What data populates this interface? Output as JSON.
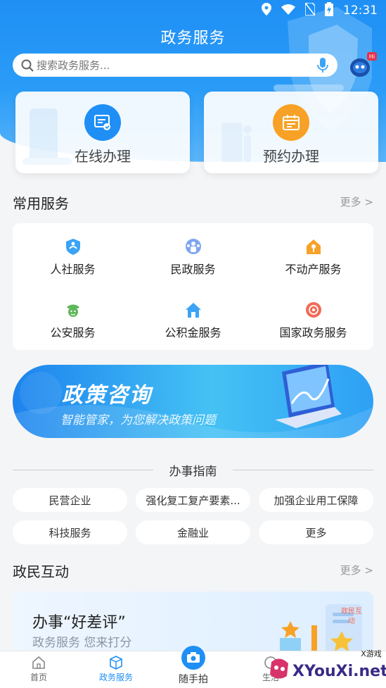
{
  "status_bar": {
    "time": "12:31"
  },
  "header": {
    "title": "政务服务",
    "search_placeholder": "搜索政务服务...",
    "robot_badge": "Hi"
  },
  "top_cards": [
    {
      "label": "在线办理",
      "color": "#1f8ff5"
    },
    {
      "label": "预约办理",
      "color": "#f7a227"
    }
  ],
  "common_services": {
    "title": "常用服务",
    "more": "更多 >",
    "items": [
      {
        "label": "人社服务",
        "icon": "people-badge-icon"
      },
      {
        "label": "民政服务",
        "icon": "civil-affairs-icon"
      },
      {
        "label": "不动产服务",
        "icon": "house-key-icon"
      },
      {
        "label": "公安服务",
        "icon": "police-icon"
      },
      {
        "label": "公积金服务",
        "icon": "home-fund-icon"
      },
      {
        "label": "国家政务服务",
        "icon": "national-emblem-icon"
      }
    ]
  },
  "banner": {
    "title": "政策咨询",
    "subtitle": "智能管家，为您解决政策问题"
  },
  "guide": {
    "title": "办事指南",
    "tags": [
      "民营企业",
      "强化复工复产要素...",
      "加强企业用工保障",
      "科技服务",
      "金融业",
      "更多"
    ]
  },
  "interaction": {
    "title": "政民互动",
    "more": "更多 >",
    "card_title": "办事“好差评”",
    "card_subtitle": "政务服务 您来打分",
    "card_badge": "政民互动"
  },
  "bottom_nav": {
    "items": [
      {
        "label": "首页",
        "active": false
      },
      {
        "label": "政务服务",
        "active": true
      },
      {
        "label": "随手拍",
        "active": false
      },
      {
        "label": "生活",
        "active": false
      }
    ]
  },
  "watermark": {
    "text": "XYouXi.net",
    "sub": "X游戏"
  },
  "colors": {
    "primary": "#1f8ff5",
    "orange": "#f7a227",
    "red": "#f06b57",
    "green": "#5fb85a"
  }
}
